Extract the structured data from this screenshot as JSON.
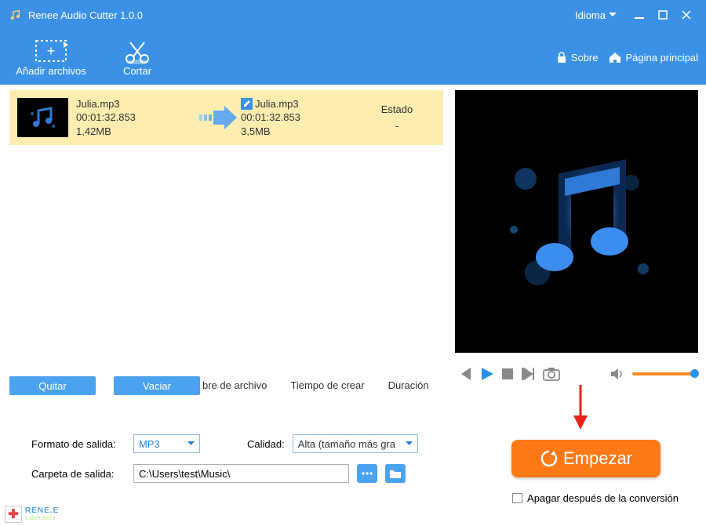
{
  "titlebar": {
    "title": "Renee Audio Cutter 1.0.0",
    "language_label": "Idioma"
  },
  "toolbar": {
    "add_files": "Añadir archivos",
    "cut": "Cortar",
    "about": "Sobre",
    "home": "Página principal"
  },
  "file": {
    "src_name": "Julia.mp3",
    "src_duration": "00:01:32.853",
    "src_size": "1,42MB",
    "dst_name": "Julia.mp3",
    "dst_duration": "00:01:32.853",
    "dst_size": "3,5MB",
    "status_header": "Estado",
    "status_value": "-"
  },
  "actions": {
    "remove": "Quitar",
    "clear": "Vaciar"
  },
  "columns": {
    "filename": "bre de archivo",
    "created": "Tiempo de crear",
    "duration": "Duración"
  },
  "settings": {
    "format_label": "Formato de salida:",
    "format_value": "MP3",
    "quality_label": "Calidad:",
    "quality_value": "Alta (tamaño más gra",
    "folder_label": "Carpeta de salida:",
    "folder_value": "C:\\Users\\test\\Music\\"
  },
  "start_label": "Empezar",
  "shutdown_label": "Apagar después de la conversión",
  "footer": {
    "brand": "RENE.E",
    "sub": "Laboratory"
  }
}
